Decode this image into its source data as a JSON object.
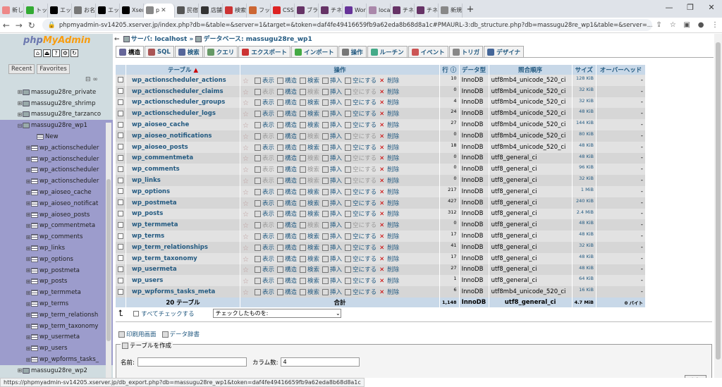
{
  "browser": {
    "tabs": [
      {
        "label": "新しい",
        "color": "#e88"
      },
      {
        "label": "トップ",
        "color": "#3a3"
      },
      {
        "label": "エック",
        "color": "#000"
      },
      {
        "label": "お名前",
        "color": "#777"
      },
      {
        "label": "エック",
        "color": "#000"
      },
      {
        "label": "Xserv",
        "color": "#000"
      },
      {
        "label": "p",
        "color": "#888",
        "active": true
      },
      {
        "label": "民宿",
        "color": "#555"
      },
      {
        "label": "店舗",
        "color": "#333"
      },
      {
        "label": "検索",
        "color": "#c33"
      },
      {
        "label": "フック",
        "color": "#c63"
      },
      {
        "label": "CSS(",
        "color": "#d22"
      },
      {
        "label": "ブラグ",
        "color": "#636"
      },
      {
        "label": "チネス",
        "color": "#636"
      },
      {
        "label": "Word",
        "color": "#639"
      },
      {
        "label": "local",
        "color": "#a8a"
      },
      {
        "label": "チネス",
        "color": "#636"
      },
      {
        "label": "チネス",
        "color": "#636"
      },
      {
        "label": "新規",
        "color": "#888"
      }
    ],
    "new_tab": "+",
    "url": "phpmyadmin-sv14205.xserver.jp/index.php?db=&table=&server=1&target=&token=daf4fe49416659fb9a62eda8b68d8a1c#PMAURL-3:db_structure.php?db=massugu28re_wp1&table=&server=..."
  },
  "sidebar": {
    "logo_php": "php",
    "logo_myadmin": "MyAdmin",
    "recent_label": "Recent",
    "favorites_label": "Favorites",
    "databases": [
      {
        "name": "massugu28re_private"
      },
      {
        "name": "massugu28re_shrimp"
      },
      {
        "name": "massugu28re_tarzanco"
      },
      {
        "name": "massugu28re_wp1",
        "selected": true
      }
    ],
    "new_label": "New",
    "tables": [
      "wp_actionscheduler",
      "wp_actionscheduler",
      "wp_actionscheduler",
      "wp_actionscheduler",
      "wp_aioseo_cache",
      "wp_aioseo_notificat",
      "wp_aioseo_posts",
      "wp_commentmeta",
      "wp_comments",
      "wp_links",
      "wp_options",
      "wp_postmeta",
      "wp_posts",
      "wp_termmeta",
      "wp_terms",
      "wp_term_relationsh",
      "wp_term_taxonomy",
      "wp_usermeta",
      "wp_users",
      "wp_wpforms_tasks_"
    ],
    "next_db": "massugu28re_wp2"
  },
  "breadcrumb": {
    "server_label": "サーバ: localhost",
    "sep": "»",
    "db_label": "データベース: massugu28re_wp1"
  },
  "menu": [
    "構造",
    "SQL",
    "検索",
    "クエリ",
    "エクスポート",
    "インポート",
    "操作",
    "ルーチン",
    "イベント",
    "トリガ",
    "デザイナ"
  ],
  "table_headers": {
    "table": "テーブル",
    "sort_arrow": "▲",
    "ops": "操作",
    "rows": "行",
    "rows_help": "ⓘ",
    "type": "データ型",
    "collation": "照合順序",
    "size": "サイズ",
    "overhead": "オーバーヘッド"
  },
  "actions": {
    "browse": "表示",
    "structure": "構造",
    "search": "検索",
    "insert": "挿入",
    "empty": "空にする",
    "drop": "削除"
  },
  "tables": [
    {
      "name": "wp_actionscheduler_actions",
      "rows": "10",
      "type": "InnoDB",
      "collation": "utf8mb4_unicode_520_ci",
      "size": "128 KiB",
      "overhead": "-",
      "empty": false
    },
    {
      "name": "wp_actionscheduler_claims",
      "rows": "0",
      "type": "InnoDB",
      "collation": "utf8mb4_unicode_520_ci",
      "size": "32 KiB",
      "overhead": "-",
      "empty": true
    },
    {
      "name": "wp_actionscheduler_groups",
      "rows": "4",
      "type": "InnoDB",
      "collation": "utf8mb4_unicode_520_ci",
      "size": "32 KiB",
      "overhead": "-",
      "empty": false
    },
    {
      "name": "wp_actionscheduler_logs",
      "rows": "24",
      "type": "InnoDB",
      "collation": "utf8mb4_unicode_520_ci",
      "size": "48 KiB",
      "overhead": "-",
      "empty": false
    },
    {
      "name": "wp_aioseo_cache",
      "rows": "27",
      "type": "InnoDB",
      "collation": "utf8mb4_unicode_520_ci",
      "size": "144 KiB",
      "overhead": "-",
      "empty": false
    },
    {
      "name": "wp_aioseo_notifications",
      "rows": "0",
      "type": "InnoDB",
      "collation": "utf8mb4_unicode_520_ci",
      "size": "80 KiB",
      "overhead": "-",
      "empty": true
    },
    {
      "name": "wp_aioseo_posts",
      "rows": "18",
      "type": "InnoDB",
      "collation": "utf8mb4_unicode_520_ci",
      "size": "48 KiB",
      "overhead": "-",
      "empty": false
    },
    {
      "name": "wp_commentmeta",
      "rows": "0",
      "type": "InnoDB",
      "collation": "utf8_general_ci",
      "size": "48 KiB",
      "overhead": "-",
      "empty": true
    },
    {
      "name": "wp_comments",
      "rows": "0",
      "type": "InnoDB",
      "collation": "utf8_general_ci",
      "size": "96 KiB",
      "overhead": "-",
      "empty": true
    },
    {
      "name": "wp_links",
      "rows": "0",
      "type": "InnoDB",
      "collation": "utf8_general_ci",
      "size": "32 KiB",
      "overhead": "-",
      "empty": true
    },
    {
      "name": "wp_options",
      "rows": "217",
      "type": "InnoDB",
      "collation": "utf8_general_ci",
      "size": "1 MiB",
      "overhead": "-",
      "empty": false
    },
    {
      "name": "wp_postmeta",
      "rows": "427",
      "type": "InnoDB",
      "collation": "utf8_general_ci",
      "size": "240 KiB",
      "overhead": "-",
      "empty": false
    },
    {
      "name": "wp_posts",
      "rows": "312",
      "type": "InnoDB",
      "collation": "utf8_general_ci",
      "size": "2.4 MiB",
      "overhead": "-",
      "empty": false
    },
    {
      "name": "wp_termmeta",
      "rows": "0",
      "type": "InnoDB",
      "collation": "utf8_general_ci",
      "size": "48 KiB",
      "overhead": "-",
      "empty": true
    },
    {
      "name": "wp_terms",
      "rows": "17",
      "type": "InnoDB",
      "collation": "utf8_general_ci",
      "size": "48 KiB",
      "overhead": "-",
      "empty": false
    },
    {
      "name": "wp_term_relationships",
      "rows": "41",
      "type": "InnoDB",
      "collation": "utf8_general_ci",
      "size": "32 KiB",
      "overhead": "-",
      "empty": false
    },
    {
      "name": "wp_term_taxonomy",
      "rows": "17",
      "type": "InnoDB",
      "collation": "utf8_general_ci",
      "size": "48 KiB",
      "overhead": "-",
      "empty": false
    },
    {
      "name": "wp_usermeta",
      "rows": "27",
      "type": "InnoDB",
      "collation": "utf8_general_ci",
      "size": "48 KiB",
      "overhead": "-",
      "empty": false
    },
    {
      "name": "wp_users",
      "rows": "1",
      "type": "InnoDB",
      "collation": "utf8_general_ci",
      "size": "64 KiB",
      "overhead": "-",
      "empty": false
    },
    {
      "name": "wp_wpforms_tasks_meta",
      "rows": "6",
      "type": "InnoDB",
      "collation": "utf8mb4_unicode_520_ci",
      "size": "16 KiB",
      "overhead": "-",
      "empty": false
    }
  ],
  "footer_row": {
    "count": "20 テーブル",
    "sum": "合計",
    "rows": "1,148",
    "type": "InnoDB",
    "collation": "utf8_general_ci",
    "size": "4.7 MiB",
    "overhead": "0 バイト"
  },
  "bulk": {
    "check_all": "すべてチェックする",
    "select_value": "チェックしたものを:"
  },
  "links": {
    "print": "印刷用画面",
    "dict": "データ辞書"
  },
  "create_table": {
    "legend": "テーブルを作成",
    "name_label": "名前:",
    "cols_label": "カラム数:",
    "cols_value": "4",
    "go": "実行"
  },
  "status_url": "https://phpmyadmin-sv14205.xserver.jp/db_export.php?db=massugu28re_wp1&token=daf4fe49416659fb9a62eda8b68d8a1c"
}
